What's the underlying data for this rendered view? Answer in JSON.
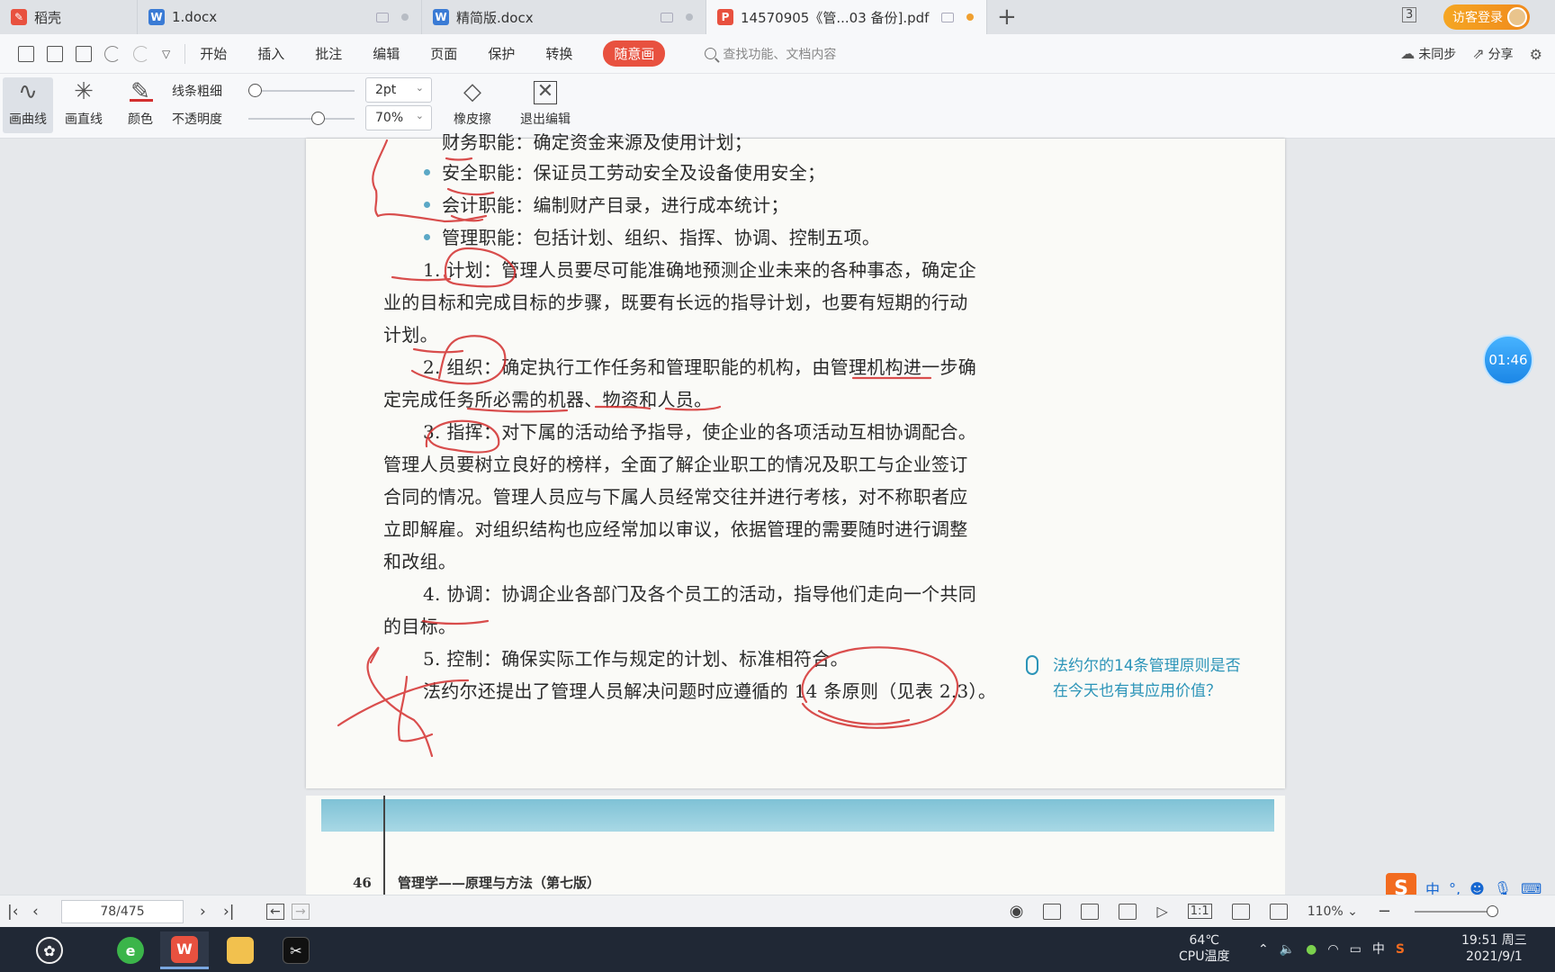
{
  "tabs": [
    {
      "label": "稻壳",
      "icon": "daoke-icon",
      "color": "#e8513f"
    },
    {
      "label": "1.docx",
      "icon": "word-doc-icon",
      "color": "#3a7bd5"
    },
    {
      "label": "精简版.docx",
      "icon": "word-doc-icon",
      "color": "#3a7bd5"
    },
    {
      "label": "14570905《管...03 备份].pdf",
      "icon": "pdf-icon",
      "color": "#e8513f"
    }
  ],
  "tab_count": "3",
  "login_label": "访客登录",
  "menu": [
    "开始",
    "插入",
    "批注",
    "编辑",
    "页面",
    "保护",
    "转换",
    "随意画"
  ],
  "search_placeholder": "查找功能、文档内容",
  "sync_label": "未同步",
  "share_label": "分享",
  "draw_tools": {
    "curve": "画曲线",
    "line": "画直线",
    "color": "颜色",
    "thickness_label": "线条粗细",
    "thickness_value": "2pt",
    "opacity_label": "不透明度",
    "opacity_value": "70%",
    "eraser": "橡皮擦",
    "exit": "退出编辑"
  },
  "doc": {
    "line_top": "财务职能：确定资金来源及使用计划；",
    "bullets": [
      "安全职能：保证员工劳动安全及设备使用安全；",
      "会计职能：编制财产目录，进行成本统计；",
      "管理职能：包括计划、组织、指挥、协调、控制五项。"
    ],
    "p1_a": "1. 计划：管理人员要尽可能准确地预测企业未来的各种事态，确定企",
    "p1_b": "业的目标和完成目标的步骤，既要有长远的指导计划，也要有短期的行动",
    "p1_c": "计划。",
    "p2_a": "2. 组织：确定执行工作任务和管理职能的机构，由管理机构进一步确",
    "p2_b": "定完成任务所必需的机器、物资和人员。",
    "p3_a": "3. 指挥：对下属的活动给予指导，使企业的各项活动互相协调配合。",
    "p3_b": "管理人员要树立良好的榜样，全面了解企业职工的情况及职工与企业签订",
    "p3_c": "合同的情况。管理人员应与下属人员经常交往并进行考核，对不称职者应",
    "p3_d": "立即解雇。对组织结构也应经常加以审议，依据管理的需要随时进行调整",
    "p3_e": "和改组。",
    "p4_a": "4. 协调：协调企业各部门及各个员工的活动，指导他们走向一个共同",
    "p4_b": "的目标。",
    "p5": "5. 控制：确保实际工作与规定的计划、标准相符合。",
    "p6": "法约尔还提出了管理人员解决问题时应遵循的 14 条原则（见表 2.3）。",
    "side_note_1": "法约尔的14条管理原则是否",
    "side_note_2": "在今天也有其应用价值？",
    "next_page_number": "46",
    "next_page_title": "管理学——原理与方法（第七版）"
  },
  "timer": "01:46",
  "page_indicator": "78/475",
  "zoom": "110%",
  "ime": {
    "mode": "中",
    "punct": "°,"
  },
  "tray": {
    "temp": "64℃",
    "temp_label": "CPU温度",
    "lang": "中",
    "time": "19:51 周三",
    "date": "2021/9/1"
  },
  "colors": {
    "accent": "#e8513f",
    "ink": "#d32f2f",
    "timer": "#1b86e6"
  }
}
